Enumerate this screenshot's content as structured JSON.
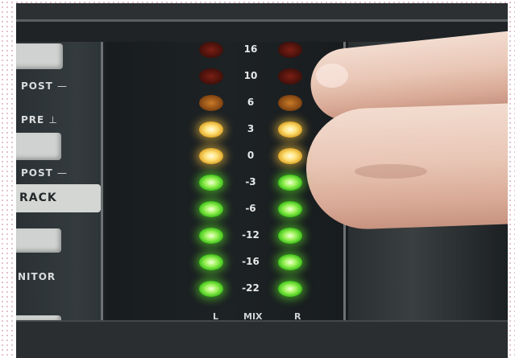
{
  "scene": {
    "description_source": "photo of mixer meter bridge",
    "colors": {
      "green_led": "#7be33a",
      "yellow_led": "#ffd95a",
      "amber_led": "#a95b1d",
      "red_led": "#5e1711"
    }
  },
  "left_panel": {
    "labels": [
      "POST",
      "PRE",
      "POST",
      "RACK",
      "NITOR"
    ]
  },
  "meter": {
    "scale": [
      "16",
      "10",
      "6",
      "3",
      "0",
      "-3",
      "-6",
      "-12",
      "-16",
      "-22"
    ],
    "led_colors": [
      "red",
      "red",
      "amber",
      "yellow",
      "yellow",
      "green",
      "green",
      "green",
      "green",
      "green"
    ],
    "footer_left": "L",
    "footer_mid": "MIX",
    "footer_right": "R"
  }
}
